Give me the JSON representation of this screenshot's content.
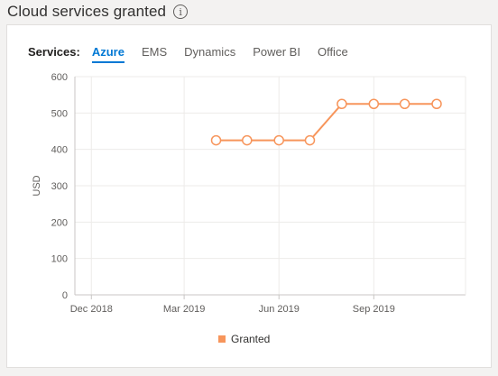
{
  "page": {
    "title": "Cloud services granted",
    "info_glyph": "i"
  },
  "tabs": {
    "label": "Services:",
    "items": [
      "Azure",
      "EMS",
      "Dynamics",
      "Power BI",
      "Office"
    ],
    "selected": "Azure"
  },
  "colors": {
    "series": "#f7955b",
    "accent": "#0078d4"
  },
  "chart_data": {
    "type": "line",
    "xlabel": "",
    "ylabel": "USD",
    "ylim": [
      0,
      600
    ],
    "yticks": [
      0,
      100,
      200,
      300,
      400,
      500,
      600
    ],
    "xlim": [
      "2018-11-15",
      "2019-11-29"
    ],
    "xticks": [
      {
        "date": "2018-12-01",
        "label": "Dec 2018"
      },
      {
        "date": "2019-03-01",
        "label": "Mar 2019"
      },
      {
        "date": "2019-06-01",
        "label": "Jun 2019"
      },
      {
        "date": "2019-09-01",
        "label": "Sep 2019"
      }
    ],
    "series": [
      {
        "name": "Granted",
        "points": [
          {
            "x": "2019-04-01",
            "y": 425
          },
          {
            "x": "2019-05-01",
            "y": 425
          },
          {
            "x": "2019-06-01",
            "y": 425
          },
          {
            "x": "2019-07-01",
            "y": 425
          },
          {
            "x": "2019-08-01",
            "y": 525
          },
          {
            "x": "2019-09-01",
            "y": 525
          },
          {
            "x": "2019-10-01",
            "y": 525
          },
          {
            "x": "2019-11-01",
            "y": 525
          }
        ]
      }
    ],
    "grid": true,
    "legend": "bottom-center"
  }
}
